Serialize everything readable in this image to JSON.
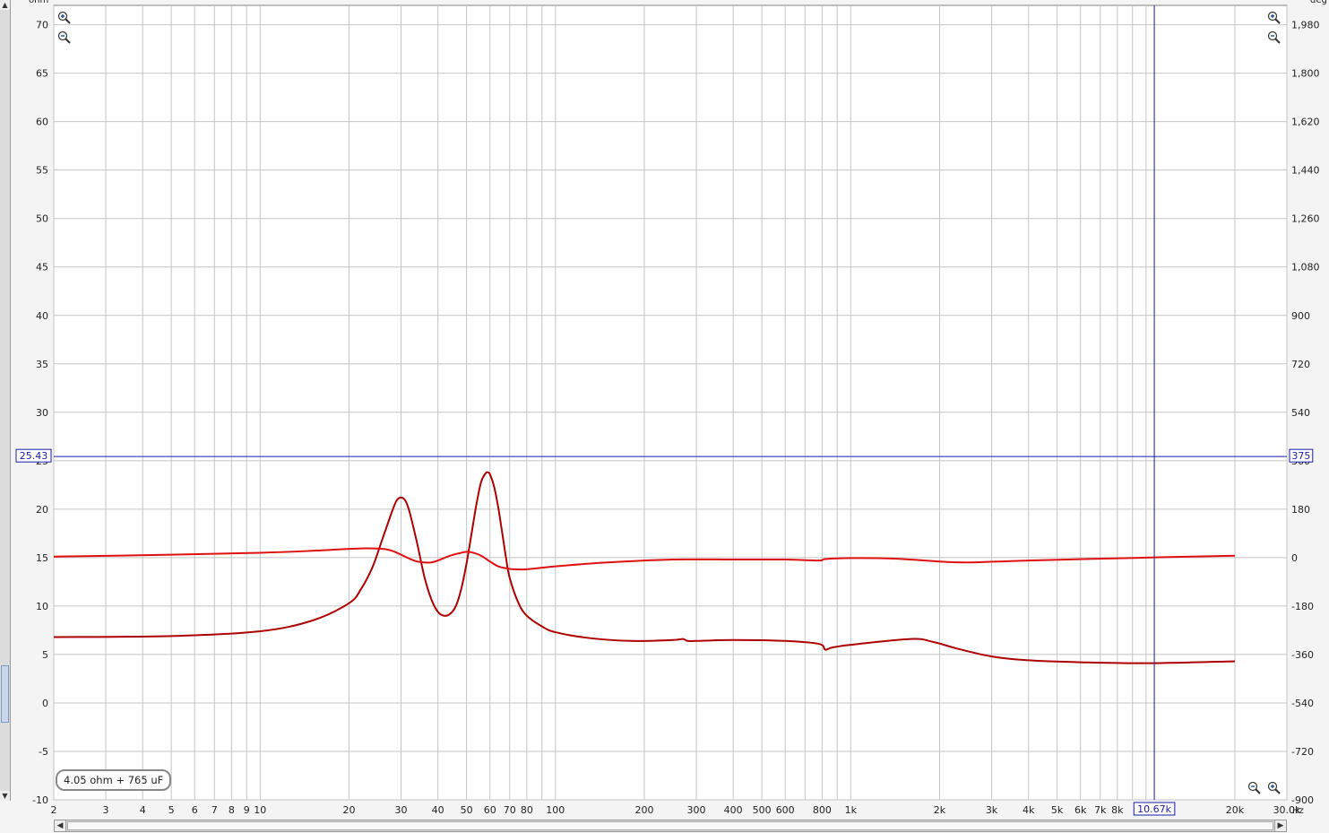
{
  "chart_data": {
    "type": "line",
    "x_unit": "Hz",
    "y_left_unit": "ohm",
    "y_right_unit": "deg",
    "x_scale": "log",
    "xlim": [
      2,
      30000
    ],
    "ylim_left": [
      -10,
      72
    ],
    "ylim_right": [
      -900,
      2052
    ],
    "y_left_ticks": [
      "70",
      "65",
      "60",
      "55",
      "50",
      "45",
      "40",
      "35",
      "30",
      "25",
      "20",
      "15",
      "10",
      "5",
      "0",
      "-5",
      "-10"
    ],
    "y_right_ticks": [
      "1,980",
      "1,800",
      "1,620",
      "1,440",
      "1,260",
      "1,080",
      "900",
      "720",
      "540",
      "360",
      "180",
      "0",
      "-180",
      "-360",
      "-540",
      "-720",
      "-900"
    ],
    "x_tick_labels": [
      {
        "v": 2,
        "t": "2"
      },
      {
        "v": 3,
        "t": "3"
      },
      {
        "v": 4,
        "t": "4"
      },
      {
        "v": 5,
        "t": "5"
      },
      {
        "v": 6,
        "t": "6"
      },
      {
        "v": 7,
        "t": "7"
      },
      {
        "v": 8,
        "t": "8"
      },
      {
        "v": 9,
        "t": "9"
      },
      {
        "v": 10,
        "t": "10"
      },
      {
        "v": 20,
        "t": "20"
      },
      {
        "v": 30,
        "t": "30"
      },
      {
        "v": 40,
        "t": "40"
      },
      {
        "v": 50,
        "t": "50"
      },
      {
        "v": 60,
        "t": "60"
      },
      {
        "v": 70,
        "t": "70"
      },
      {
        "v": 80,
        "t": "80"
      },
      {
        "v": 100,
        "t": "100"
      },
      {
        "v": 200,
        "t": "200"
      },
      {
        "v": 300,
        "t": "300"
      },
      {
        "v": 400,
        "t": "400"
      },
      {
        "v": 500,
        "t": "500"
      },
      {
        "v": 600,
        "t": "600"
      },
      {
        "v": 800,
        "t": "800"
      },
      {
        "v": 1000,
        "t": "1k"
      },
      {
        "v": 2000,
        "t": "2k"
      },
      {
        "v": 3000,
        "t": "3k"
      },
      {
        "v": 4000,
        "t": "4k"
      },
      {
        "v": 5000,
        "t": "5k"
      },
      {
        "v": 6000,
        "t": "6k"
      },
      {
        "v": 7000,
        "t": "7k"
      },
      {
        "v": 8000,
        "t": "8k"
      },
      {
        "v": 20000,
        "t": "20k"
      },
      {
        "v": 30000,
        "t": "30.0k"
      }
    ],
    "cursor": {
      "x": 10670,
      "x_label": "10.67k",
      "y": 25.43,
      "y_label": "25.43",
      "y_right_label": "375"
    },
    "annotation": "4.05 ohm + 765 uF",
    "grid": true,
    "series": [
      {
        "color": "#ad0000",
        "axis": "left",
        "x": [
          2,
          5,
          10,
          15,
          20,
          22,
          24,
          26,
          28,
          29,
          30,
          31,
          32,
          34,
          36,
          38,
          40,
          42,
          44,
          46,
          48,
          50,
          52,
          54,
          56,
          58,
          59,
          60,
          62,
          64,
          66,
          68,
          70,
          75,
          80,
          90,
          100,
          130,
          180,
          250,
          270,
          280,
          300,
          400,
          600,
          780,
          820,
          860,
          1000,
          1600,
          1900,
          2300,
          3000,
          4000,
          6000,
          10000,
          20000
        ],
        "y": [
          6.8,
          6.9,
          7.4,
          8.5,
          10.3,
          11.8,
          14.0,
          17.0,
          19.8,
          20.9,
          21.2,
          20.9,
          19.8,
          16.5,
          13.0,
          10.7,
          9.4,
          9.0,
          9.2,
          10.0,
          11.8,
          14.4,
          17.5,
          20.5,
          22.8,
          23.7,
          23.8,
          23.6,
          22.3,
          20.2,
          17.6,
          15.0,
          12.9,
          10.3,
          9.0,
          7.9,
          7.3,
          6.7,
          6.4,
          6.5,
          6.6,
          6.4,
          6.4,
          6.5,
          6.4,
          6.1,
          5.5,
          5.7,
          6.0,
          6.6,
          6.3,
          5.6,
          4.8,
          4.4,
          4.2,
          4.1,
          4.3
        ]
      },
      {
        "color": "#e01010",
        "axis": "left",
        "x": [
          2,
          5,
          10,
          15,
          20,
          22,
          24,
          26,
          28,
          30,
          32,
          34,
          36,
          38,
          40,
          44,
          48,
          50,
          52,
          56,
          60,
          64,
          68,
          72,
          80,
          100,
          150,
          250,
          400,
          600,
          780,
          820,
          1000,
          1400,
          2000,
          2500,
          4000,
          10000,
          20000
        ],
        "y": [
          15.1,
          15.3,
          15.5,
          15.7,
          15.9,
          15.95,
          15.95,
          15.9,
          15.7,
          15.3,
          14.9,
          14.6,
          14.5,
          14.5,
          14.7,
          15.2,
          15.5,
          15.6,
          15.55,
          15.2,
          14.6,
          14.1,
          13.9,
          13.8,
          13.8,
          14.1,
          14.5,
          14.8,
          14.8,
          14.8,
          14.7,
          14.85,
          14.95,
          14.9,
          14.6,
          14.5,
          14.7,
          15.0,
          15.2
        ]
      }
    ]
  }
}
